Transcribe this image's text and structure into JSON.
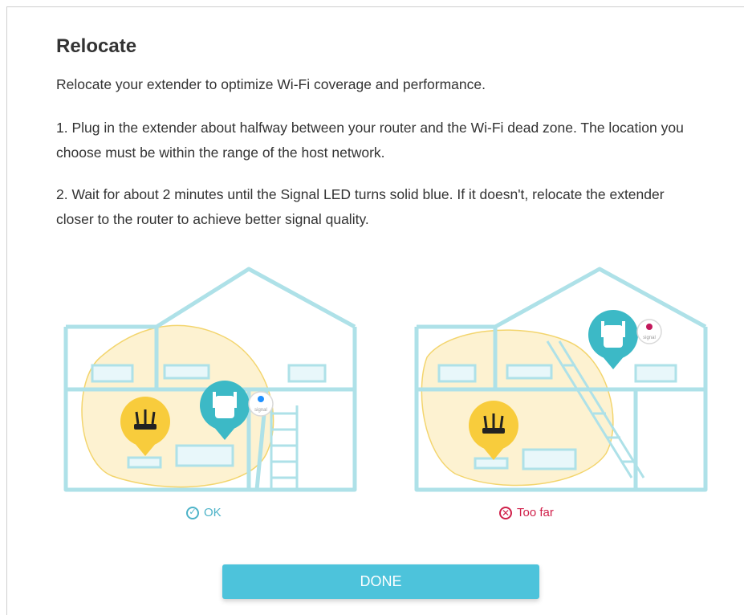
{
  "title": "Relocate",
  "intro": "Relocate your extender to optimize Wi-Fi coverage and performance.",
  "steps": [
    "1. Plug in the extender about halfway between your router and the Wi-Fi dead zone. The location you choose must be within the range of the host network.",
    "2. Wait for about 2 minutes until the Signal LED turns solid blue. If it doesn't, relocate the extender closer to the router to achieve better signal quality."
  ],
  "illustrations": {
    "good": {
      "status_label": "OK",
      "signal_text": "signal",
      "led_color": "#1e90ff"
    },
    "bad": {
      "status_label": "Too far",
      "signal_text": "signal",
      "led_color": "#c2185b"
    }
  },
  "done_button": "DONE",
  "colors": {
    "accent": "#4dc3db",
    "ok": "#4db3c8",
    "error": "#d0204a",
    "coverage": "#fbe39a",
    "house_outline": "#aee1e8"
  }
}
